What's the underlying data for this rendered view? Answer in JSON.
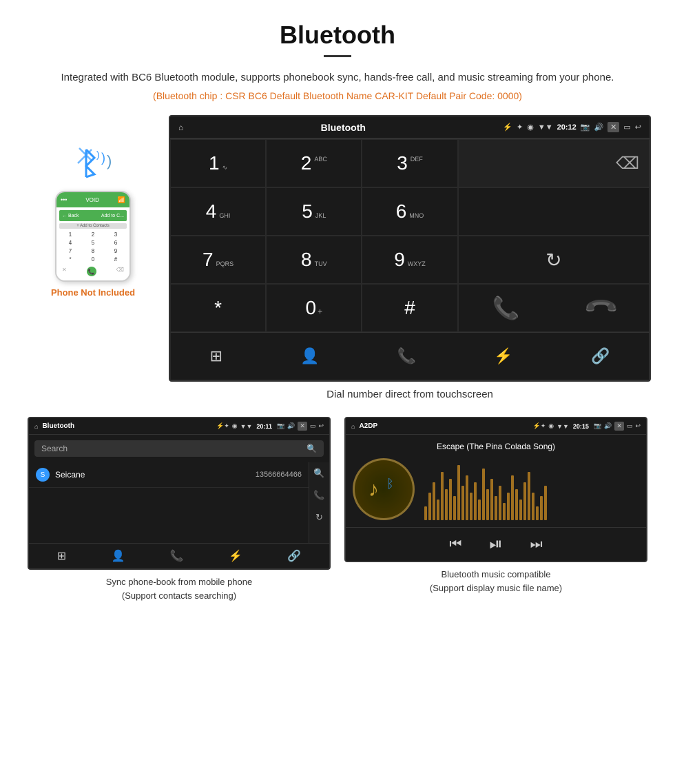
{
  "header": {
    "title": "Bluetooth",
    "description": "Integrated with BC6 Bluetooth module, supports phonebook sync, hands-free call, and music streaming from your phone.",
    "specs": "(Bluetooth chip : CSR BC6    Default Bluetooth Name CAR-KIT    Default Pair Code: 0000)"
  },
  "phone_note": "Phone Not Included",
  "dial_screen": {
    "status_bar": {
      "home_icon": "⌂",
      "title": "Bluetooth",
      "usb_icon": "⚡",
      "bt_icon": "✦",
      "location_icon": "◉",
      "signal_icon": "▼",
      "time": "20:12",
      "camera_icon": "📷",
      "volume_icon": "🔊",
      "close_icon": "✕",
      "window_icon": "▭",
      "back_icon": "↩"
    },
    "keys": [
      {
        "num": "1",
        "sub": "∿"
      },
      {
        "num": "2",
        "sub": "ABC"
      },
      {
        "num": "3",
        "sub": "DEF"
      },
      {
        "num": "4",
        "sub": "GHI"
      },
      {
        "num": "5",
        "sub": "JKL"
      },
      {
        "num": "6",
        "sub": "MNO"
      },
      {
        "num": "7",
        "sub": "PQRS"
      },
      {
        "num": "8",
        "sub": "TUV"
      },
      {
        "num": "9",
        "sub": "WXYZ"
      },
      {
        "num": "*",
        "sub": ""
      },
      {
        "num": "0",
        "sub": "+"
      },
      {
        "num": "#",
        "sub": ""
      }
    ],
    "caption": "Dial number direct from touchscreen"
  },
  "phonebook_screen": {
    "status_bar_title": "Bluetooth",
    "status_bar_time": "20:11",
    "search_placeholder": "Search",
    "contact_letter": "S",
    "contact_name": "Seicane",
    "contact_number": "13566664466",
    "caption_line1": "Sync phone-book from mobile phone",
    "caption_line2": "(Support contacts searching)"
  },
  "music_screen": {
    "status_bar_title": "A2DP",
    "status_bar_time": "20:15",
    "song_title": "Escape (The Pina Colada Song)",
    "caption_line1": "Bluetooth music compatible",
    "caption_line2": "(Support display music file name)"
  }
}
